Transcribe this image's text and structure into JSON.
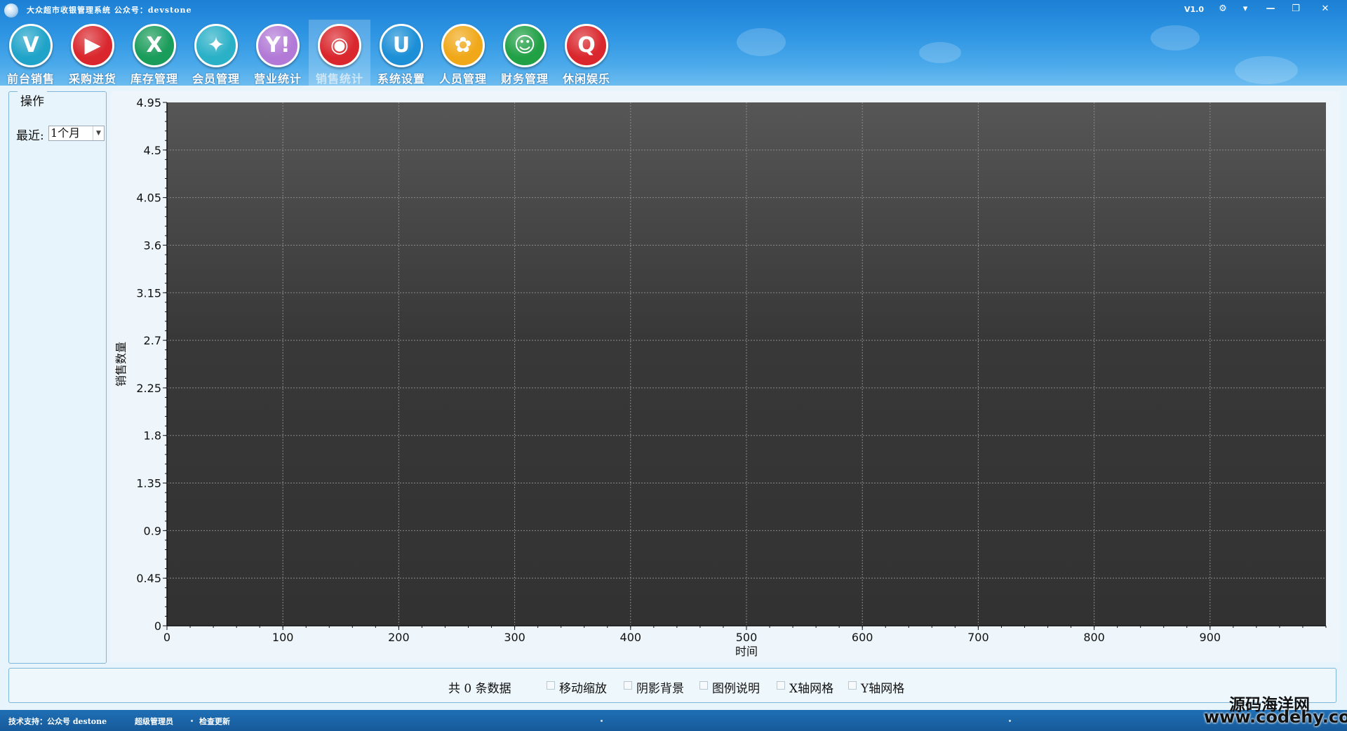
{
  "window": {
    "title": "大众超市收银管理系统   公众号：devstone",
    "version": "V1.0",
    "controls": {
      "skin": "⚙",
      "menu": "▾",
      "minimize": "—",
      "restore": "❐",
      "close": "✕"
    }
  },
  "toolbar": {
    "items": [
      {
        "label": "前台销售",
        "glyph": "V",
        "icon": "vimeo-icon",
        "color": "#1fa3c9"
      },
      {
        "label": "采购进货",
        "glyph": "▶",
        "icon": "youtube-icon",
        "color": "#d9272d"
      },
      {
        "label": "库存管理",
        "glyph": "X",
        "icon": "xing-icon",
        "color": "#1a9c5a"
      },
      {
        "label": "会员管理",
        "glyph": "✦",
        "icon": "sparkle-icon",
        "color": "#2ab0c7"
      },
      {
        "label": "营业统计",
        "glyph": "Y!",
        "icon": "yahoo-icon",
        "color": "#b27ad6"
      },
      {
        "label": "销售统计",
        "glyph": "◉",
        "icon": "weibo-icon",
        "color": "#d9272d"
      },
      {
        "label": "系统设置",
        "glyph": "U",
        "icon": "u-icon",
        "color": "#1c8fd6"
      },
      {
        "label": "人员管理",
        "glyph": "✿",
        "icon": "people-icon",
        "color": "#f0a818"
      },
      {
        "label": "财务管理",
        "glyph": "☺",
        "icon": "finance-icon",
        "color": "#21a046"
      },
      {
        "label": "休闲娱乐",
        "glyph": "Q",
        "icon": "q-icon",
        "color": "#d9272d"
      }
    ],
    "active_index": 5
  },
  "ops": {
    "title": "操作",
    "range_label": "最近:",
    "range_value": "1个月"
  },
  "chart_data": {
    "type": "line",
    "ylabel": "销售数量",
    "xlabel": "时间",
    "xlim": [
      0,
      1000
    ],
    "ylim": [
      0,
      4.95
    ],
    "x_ticks": [
      "0",
      "100",
      "200",
      "300",
      "400",
      "500",
      "600",
      "700",
      "800",
      "900"
    ],
    "y_ticks": [
      "0",
      "0.45",
      "0.9",
      "1.35",
      "1.8",
      "2.25",
      "2.7",
      "3.15",
      "3.6",
      "4.05",
      "4.5",
      "4.95"
    ],
    "grid": true,
    "series": []
  },
  "bottom": {
    "count_text": "共 0 条数据",
    "options": [
      "移动缩放",
      "阴影背景",
      "图例说明",
      "X轴网格",
      "Y轴网格"
    ]
  },
  "status": {
    "support": "技术支持：公众号 destone",
    "user": "超级管理员",
    "update": "检查更新"
  },
  "watermark": {
    "cn": "源码海洋网",
    "url": "www.codehy.com"
  }
}
